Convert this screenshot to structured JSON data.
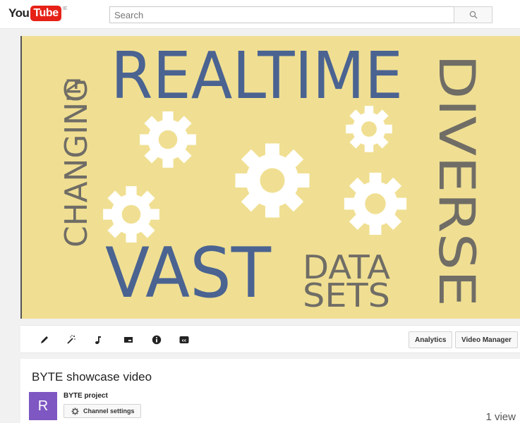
{
  "header": {
    "logo_you": "You",
    "logo_tube": "Tube",
    "logo_region": "IE",
    "search_placeholder": "Search",
    "search_icon": "magnifier-icon"
  },
  "player": {
    "thumbnail_words": {
      "realtime": "REALTIME",
      "in": "IN",
      "changing": "CHANGING",
      "diverse": "DIVERSE",
      "vast": "VAST",
      "data": "DATA",
      "sets": "SETS"
    },
    "colors": {
      "background": "#f0df92",
      "blue_text": "#4a6391",
      "gray_text": "#706d66",
      "gears": "#ffffff"
    }
  },
  "toolbar": {
    "icons": [
      "pencil-icon",
      "magic-wand-icon",
      "music-note-icon",
      "card-icon",
      "info-icon",
      "cc-icon"
    ],
    "analytics_label": "Analytics",
    "video_manager_label": "Video Manager"
  },
  "video": {
    "title": "BYTE showcase video",
    "channel_name": "BYTE project",
    "channel_initial": "R",
    "channel_settings_label": "Channel settings",
    "views": "1 view",
    "avatar_color": "#7e57c2"
  }
}
